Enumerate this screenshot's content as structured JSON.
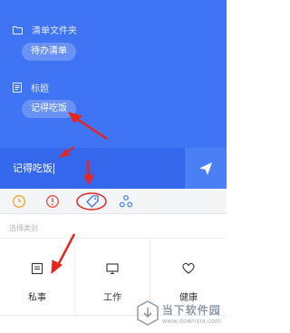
{
  "list": {
    "folder_label": "清单文件夹",
    "folder_value": "待办清单",
    "title_label": "标题",
    "title_value": "记得吃饭"
  },
  "input": {
    "value": "记得吃饭"
  },
  "toolbar": {
    "icons": [
      "clock-icon",
      "priority-icon",
      "tag-icon",
      "share-icon"
    ],
    "accent_colors": {
      "clock": "#f5a623",
      "priority": "#e74c3c",
      "tag": "#3f74f4",
      "share": "#3f74f4"
    }
  },
  "category": {
    "hint": "选择类别",
    "items": [
      {
        "label": "私事",
        "icon": "note-icon"
      },
      {
        "label": "工作",
        "icon": "monitor-icon"
      },
      {
        "label": "健康",
        "icon": "heart-icon"
      }
    ]
  },
  "watermark": {
    "title": "当下软件园",
    "url": "www.downxia.com"
  },
  "colors": {
    "primary": "#3f74f4",
    "input_bar": "#3467ec",
    "annotation": "#e8241c"
  }
}
